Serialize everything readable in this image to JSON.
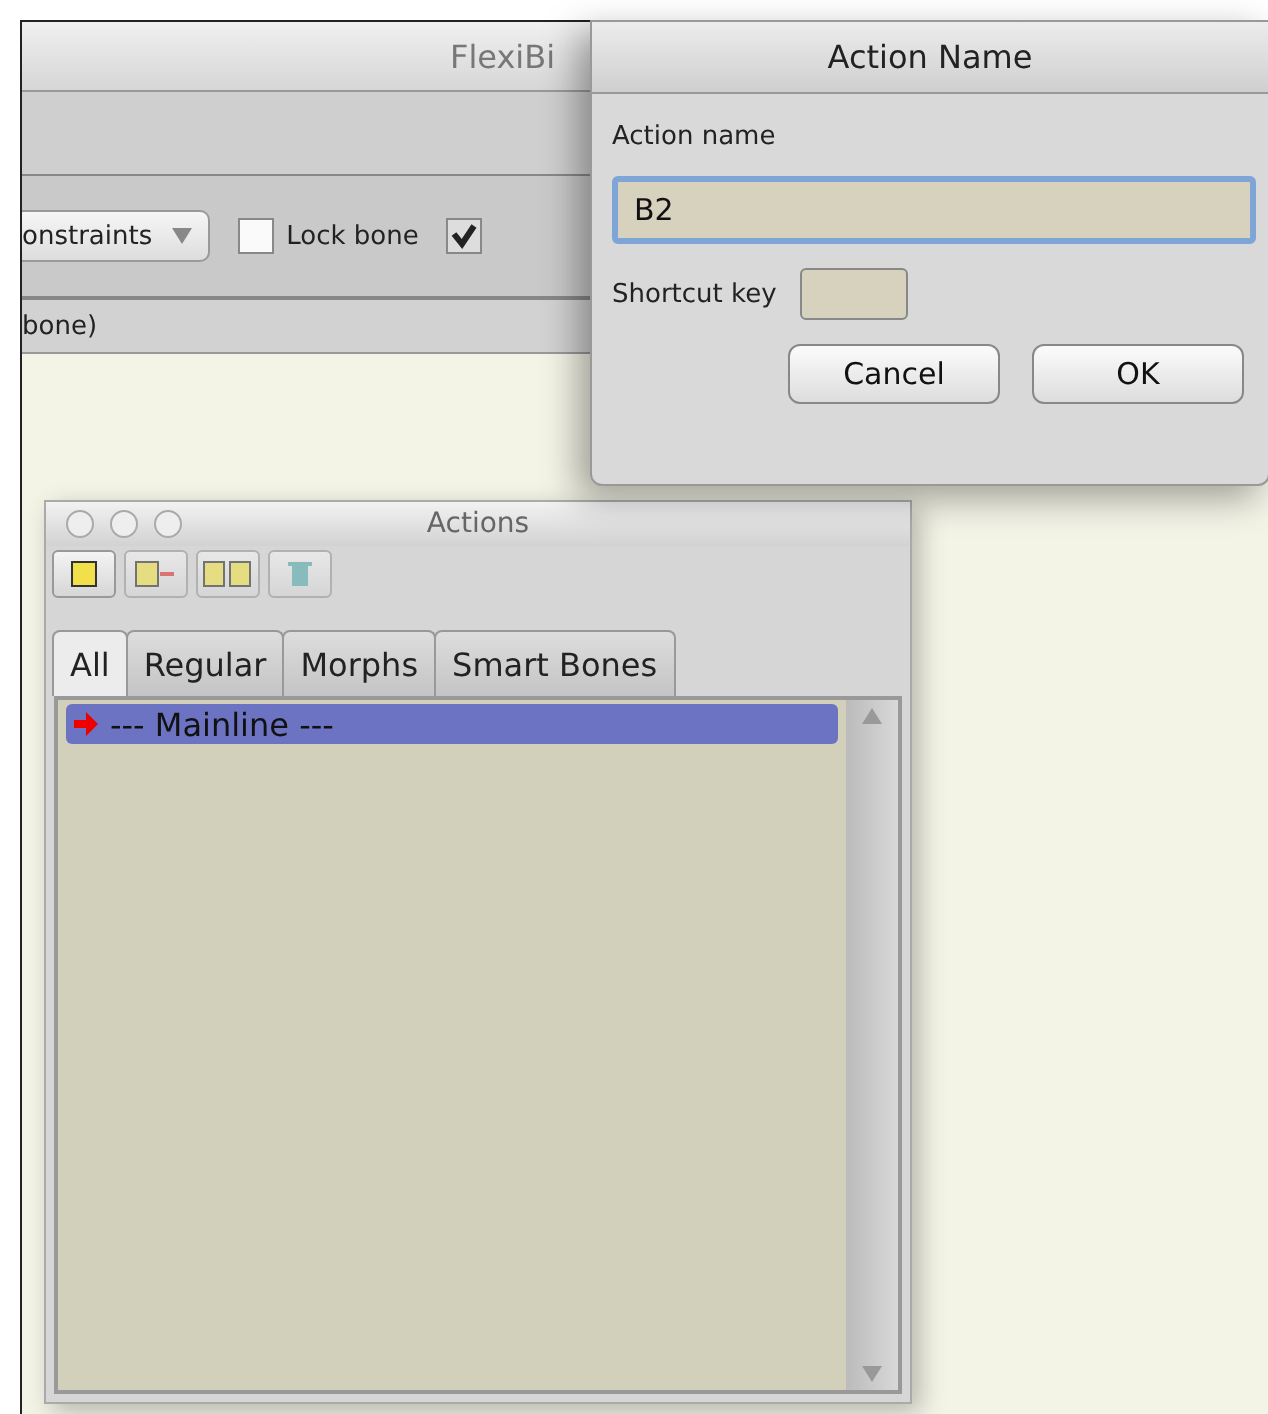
{
  "main_window": {
    "title": "FlexiBi",
    "constraints_dropdown": "onstraints",
    "checkboxes": [
      {
        "label": "Lock bone",
        "checked": false
      },
      {
        "checked": true
      }
    ],
    "status": "bone)"
  },
  "dialog": {
    "title": "Action Name",
    "name_label": "Action name",
    "name_value": "B2",
    "shortcut_label": "Shortcut key",
    "buttons": [
      "Cancel",
      "OK"
    ]
  },
  "actions_panel": {
    "title": "Actions",
    "tabs": [
      {
        "label": "All",
        "selected": true
      },
      {
        "label": "Regular",
        "selected": false
      },
      {
        "label": "Morphs",
        "selected": false
      },
      {
        "label": "Smart Bones",
        "selected": false
      }
    ],
    "items": [
      {
        "label": "--- Mainline ---",
        "selected": true
      }
    ]
  }
}
